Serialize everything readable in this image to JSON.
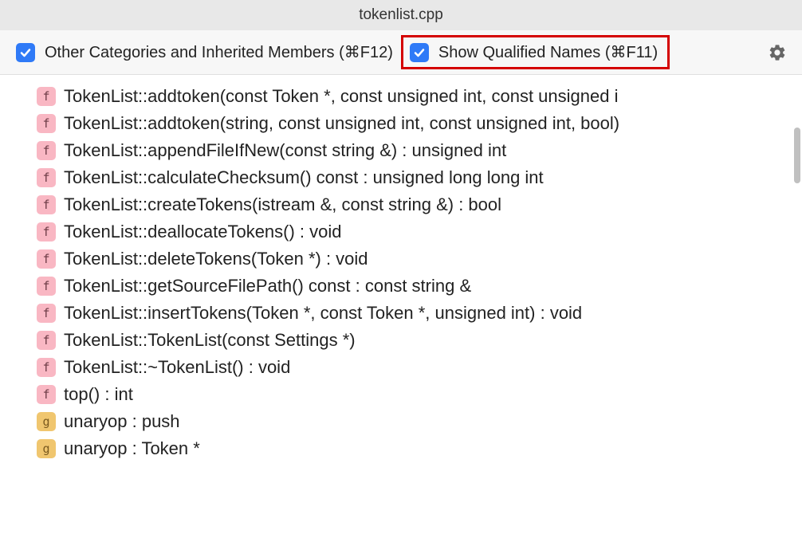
{
  "title": "tokenlist.cpp",
  "toolbar": {
    "checkbox1_label": "Other Categories and Inherited Members (⌘F12)",
    "checkbox2_label": "Show Qualified Names (⌘F11)"
  },
  "items": [
    {
      "badge": "f",
      "badgeType": "f",
      "text": "TokenList::addtoken(const Token *, const unsigned int, const unsigned i"
    },
    {
      "badge": "f",
      "badgeType": "f",
      "text": "TokenList::addtoken(string, const unsigned int, const unsigned int, bool)"
    },
    {
      "badge": "f",
      "badgeType": "f",
      "text": "TokenList::appendFileIfNew(const string &) : unsigned int"
    },
    {
      "badge": "f",
      "badgeType": "f",
      "text": "TokenList::calculateChecksum() const : unsigned long long int"
    },
    {
      "badge": "f",
      "badgeType": "f",
      "text": "TokenList::createTokens(istream &, const string &) : bool"
    },
    {
      "badge": "f",
      "badgeType": "f",
      "text": "TokenList::deallocateTokens() : void"
    },
    {
      "badge": "f",
      "badgeType": "f",
      "text": "TokenList::deleteTokens(Token *) : void"
    },
    {
      "badge": "f",
      "badgeType": "f",
      "text": "TokenList::getSourceFilePath() const : const string &"
    },
    {
      "badge": "f",
      "badgeType": "f",
      "text": "TokenList::insertTokens(Token *, const Token *, unsigned int) : void"
    },
    {
      "badge": "f",
      "badgeType": "f",
      "text": "TokenList::TokenList(const Settings *)"
    },
    {
      "badge": "f",
      "badgeType": "f",
      "text": "TokenList::~TokenList() : void"
    },
    {
      "badge": "f",
      "badgeType": "f",
      "text": "top() : int"
    },
    {
      "badge": "g",
      "badgeType": "g",
      "text": "unaryop : push"
    },
    {
      "badge": "g",
      "badgeType": "g",
      "text": "unaryop : Token *"
    }
  ]
}
